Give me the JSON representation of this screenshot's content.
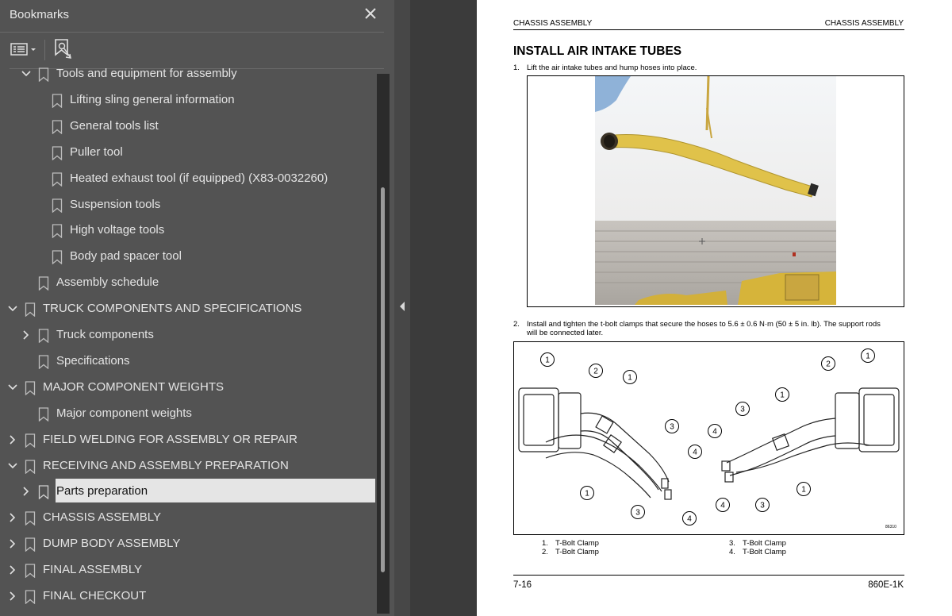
{
  "panel": {
    "title": "Bookmarks",
    "close_icon": "close-icon",
    "options_icon": "list-options-icon",
    "bookmark_icon": "bookmark-add-icon"
  },
  "tree": [
    {
      "label": "Tools and equipment for assembly",
      "level": 1,
      "toggle": "expanded"
    },
    {
      "label": "Lifting sling general information",
      "level": 2,
      "toggle": "none"
    },
    {
      "label": "General tools list",
      "level": 2,
      "toggle": "none"
    },
    {
      "label": "Puller tool",
      "level": 2,
      "toggle": "none"
    },
    {
      "label": "Heated exhaust tool (if equipped) (X83-0032260)",
      "level": 2,
      "toggle": "none"
    },
    {
      "label": "Suspension tools",
      "level": 2,
      "toggle": "none"
    },
    {
      "label": "High voltage tools",
      "level": 2,
      "toggle": "none"
    },
    {
      "label": "Body pad spacer tool",
      "level": 2,
      "toggle": "none"
    },
    {
      "label": "Assembly schedule",
      "level": 1,
      "toggle": "none"
    },
    {
      "label": "TRUCK COMPONENTS AND SPECIFICATIONS",
      "level": 0,
      "toggle": "expanded"
    },
    {
      "label": "Truck components",
      "level": 1,
      "toggle": "collapsed"
    },
    {
      "label": "Specifications",
      "level": 1,
      "toggle": "none"
    },
    {
      "label": "MAJOR COMPONENT WEIGHTS",
      "level": 0,
      "toggle": "expanded"
    },
    {
      "label": "Major component weights",
      "level": 1,
      "toggle": "none"
    },
    {
      "label": "FIELD WELDING FOR ASSEMBLY OR REPAIR",
      "level": 0,
      "toggle": "collapsed"
    },
    {
      "label": "RECEIVING AND ASSEMBLY PREPARATION",
      "level": 0,
      "toggle": "expanded"
    },
    {
      "label": "Parts preparation",
      "level": 1,
      "toggle": "collapsed",
      "selected": true
    },
    {
      "label": "CHASSIS ASSEMBLY",
      "level": 0,
      "toggle": "collapsed"
    },
    {
      "label": "DUMP BODY ASSEMBLY",
      "level": 0,
      "toggle": "collapsed"
    },
    {
      "label": "FINAL ASSEMBLY",
      "level": 0,
      "toggle": "collapsed"
    },
    {
      "label": "FINAL CHECKOUT",
      "level": 0,
      "toggle": "collapsed"
    }
  ],
  "doc": {
    "header_left": "CHASSIS ASSEMBLY",
    "header_right": "CHASSIS ASSEMBLY",
    "title": "INSTALL AIR INTAKE TUBES",
    "step1_num": "1.",
    "step1": "Lift the air intake tubes and hump hoses into place.",
    "step2_num": "2.",
    "step2_line1": "Install and tighten the t-bolt clamps that secure the hoses to 5.6 ± 0.6 N·m (50 ± 5 in. lb). The support rods",
    "step2_line2": "will be connected later.",
    "diagram_code": "86310",
    "callouts": [
      "1",
      "2",
      "1",
      "1",
      "3",
      "4",
      "3",
      "4",
      "2",
      "1",
      "1",
      "3",
      "4",
      "4",
      "3",
      "1"
    ],
    "legend": [
      {
        "num": "1.",
        "text": "T-Bolt Clamp"
      },
      {
        "num": "2.",
        "text": "T-Bolt Clamp"
      },
      {
        "num": "3.",
        "text": "T-Bolt Clamp"
      },
      {
        "num": "4.",
        "text": "T-Bolt Clamp"
      }
    ],
    "footer_left": "7-16",
    "footer_right": "860E-1K"
  },
  "colors": {
    "panel_bg": "#535353",
    "selected_bg": "#e5e5e5",
    "page_bg": "#ffffff",
    "tube_yellow": "#e0c24a"
  }
}
